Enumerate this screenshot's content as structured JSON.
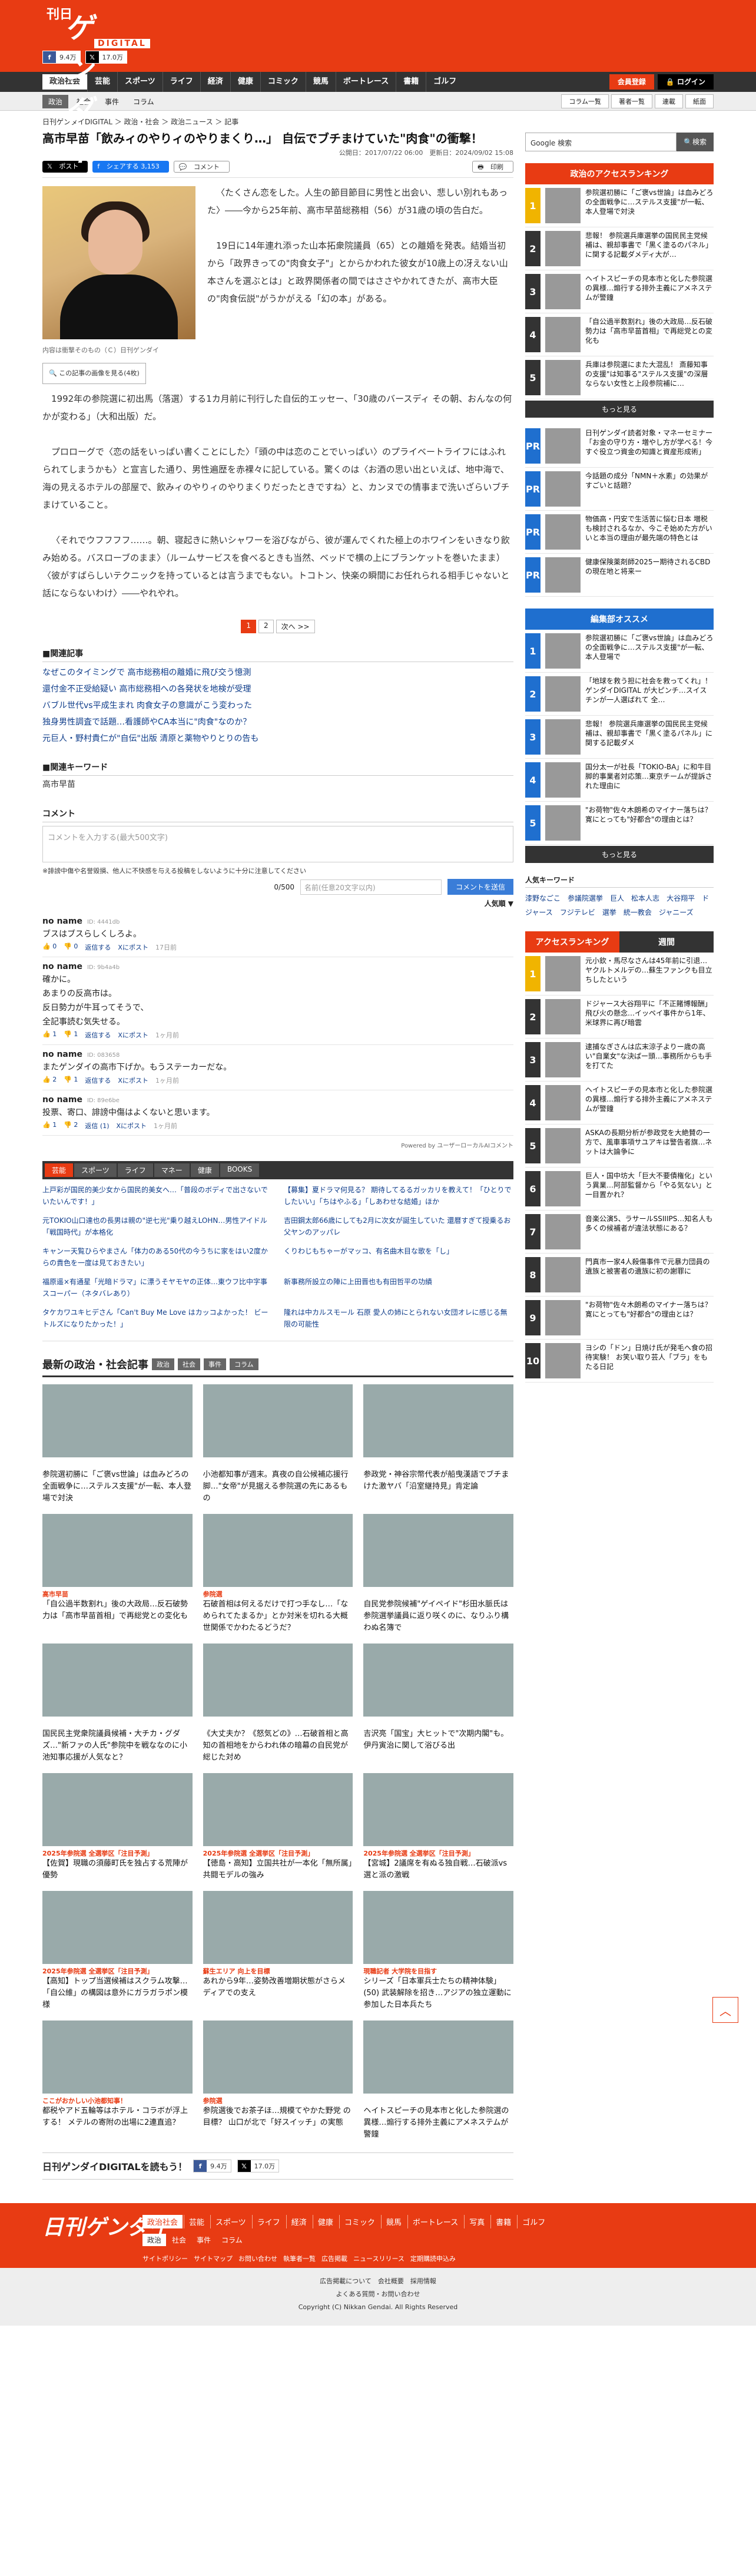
{
  "header": {
    "logo_nikkan": "日刊",
    "logo_gendai": "ゲンダイ",
    "logo_digital": "DIGITAL",
    "fb_count": "9.4万",
    "x_count": "17.0万"
  },
  "gnav": {
    "items": [
      "政治社会",
      "芸能",
      "スポーツ",
      "ライフ",
      "経済",
      "健康",
      "コミック",
      "競馬",
      "ボートレース",
      "書籍",
      "ゴルフ"
    ],
    "member": "会員登録",
    "login": "ログイン"
  },
  "snav": {
    "items": [
      "政治",
      "社会",
      "事件",
      "コラム"
    ],
    "right": [
      "コラム一覧",
      "著者一覧",
      "連載",
      "紙面"
    ]
  },
  "breadcrumb": "日刊ゲンダイDIGITAL ＞ 政治・社会 ＞ 政治ニュース ＞ 記事",
  "article": {
    "title": "高市早苗「飲みィのやりィのやりまくり…」 自伝でブチまけていた\"肉食\"の衝撃！",
    "date": "公開日：2017/07/22 06:00　更新日：2024/09/02 15:08",
    "share_x": "ポスト",
    "share_fb": "シェアする 3,153",
    "share_comment": "コメント",
    "share_print": "印刷",
    "caption": "内容は衝撃そのもの（Ｃ）日刊ゲンダイ",
    "caption_btn": "この記事の画像を見る(4枚)",
    "p1": "〈たくさん恋をした。人生の節目節目に男性と出会い、悲しい別れもあった〉――今から25年前、高市早苗総務相（56）が31歳の頃の告白だ。",
    "p2": "19日に14年連れ添った山本拓衆院議員（65）との離婚を発表。結婚当初から「政界きっての\"肉食女子\"」とからかわれた彼女が10歳上の冴えない山本さんを選ぶとは」と政界関係者の間ではささやかれてきたが、高市大臣の\"肉食伝説\"がうかがえる「幻の本」がある。",
    "p3": "1992年の参院選に初出馬（落選）する1カ月前に刊行した自伝的エッセー、「30歳のバースディ その朝、おんなの何かが変わる」（大和出版）だ。",
    "p4": "プロローグで〈恋の話をいっぱい書くことにした〉「頭の中は恋のことでいっぱい〉のプライベートライフにはふれられてしまうかも〉と宣言した通り、男性遍歴を赤裸々に記している。驚くのは〈お酒の思い出といえば、地中海で、海の見えるホテルの部屋で、飲みィのやりィのやりまくりだったときですね〉と、カンヌでの情事まで洗いざらいブチまけていること。",
    "p5": "〈それでウフフフフ……。朝、寝起きに熱いシャワーを浴びながら、彼が運んでくれた極上のホワインをいきなり飲み始める。バスローブのまま〉（ルームサービスを食べるときも当然、ベッドで横の上にブランケットを巻いたまま）〈彼がすばらしいテクニックを持っているとは言うまでもない。トコトン、快楽の瞬間にお任れられる相手じゃないと話にならないわけ〉――やれやれ。",
    "pager": [
      "1",
      "2",
      "次へ >>"
    ]
  },
  "related": {
    "title": "関連記事",
    "items": [
      "なぜこのタイミングで 高市総務相の離婚に飛び交う憶測",
      "還付金不正受給疑い 高市総務相への各発状を地検が受理",
      "バブル世代vs平成生まれ 肉食女子の意識がこう変わった",
      "独身男性調査で話題…看護師やCA本当に\"肉食\"なのか？",
      "元巨人・野村貴仁が\"自伝\"出版 清原と薬物やりとりの告も"
    ]
  },
  "keywords": {
    "title": "関連キーワード",
    "items": [
      "高市早苗"
    ]
  },
  "comment": {
    "title": "コメント",
    "placeholder": "コメントを入力する(最大500文字)",
    "note": "※誹謗中傷や名誉毀損、他人に不快感を与える投稿をしないように十分に注意してください",
    "count": "0/500",
    "name_placeholder": "名前(任意20文字以内)",
    "submit": "コメントを送信",
    "sort": "人気順 ▼",
    "list": [
      {
        "name": "no name",
        "id": "ID: 4441db",
        "text": "ブスはブスらしくしろよ。",
        "good": "0",
        "bad": "0",
        "reply": "返信する",
        "xpost": "Xにポスト",
        "time": "17日前"
      },
      {
        "name": "no name",
        "id": "ID: 9b4a4b",
        "text": "確かに。\nあまりの反高市は。\n反日勢力が牛耳ってそうで、\n全記事読む気失せる。",
        "good": "1",
        "bad": "1",
        "reply": "返信する",
        "xpost": "Xにポスト",
        "time": "1ヶ月前"
      },
      {
        "name": "no name",
        "id": "ID: 083658",
        "text": "またゲンダイの高市下げか。もうステーカーだな。",
        "good": "2",
        "bad": "1",
        "reply": "返信する",
        "xpost": "Xにポスト",
        "time": "1ヶ月前"
      },
      {
        "name": "no name",
        "id": "ID: 89e6be",
        "text": "投票、寄口、誹謗中傷はよくないと思います。",
        "good": "1",
        "bad": "2",
        "reply": "返信 (1)",
        "xpost": "Xにポスト",
        "time": "1ヶ月前"
      }
    ],
    "powered": "Powered by ユーザーローカルAIコメント"
  },
  "other_news": {
    "tabs": [
      "芸能",
      "スポーツ",
      "ライフ",
      "マネー",
      "健康",
      "BOOKS"
    ],
    "items": [
      "上戸彩が国民的美少女から国民的美女へ…「普段のボディで出さないでいたいんです！」",
      "【募集】夏ドラマ何見る？ 期待してるるガッカリを教えて！「ひとりでしたいい」「ちはやふる」「しあわせな結婚」ほか",
      "元TOKIO山口達也の長男は親の\"逆七光\"乗り越えLOHN…男性アイドル「戦国時代」が本格化",
      "吉田鋼太郎66歳にしても2月に次女が誕生していた 還暦すぎて授乗るお父ヤンのアッパレ",
      "キャンー天覧ひらやまさん「体力のある50代の今うちに家をはい2度からの貴色を一度は見ておきたい」",
      "くりわじもちゃーがマッコ、有名曲木目な歌を「し」",
      "福原遥×有通星「光暗ドラマ」に漂うそヤモヤの正体…東ウフ比中字事 スコーパー（ネタバレあり）",
      "新事務所設立の陣に上田晋也も有田哲平の功績",
      "タケカワユキヒデさん「Can't Buy Me Love はカッコよかった！ ビートルズになりたかった！」",
      "隆れは中カルスモール 石原 愛人の姉にとられない女団オレに感じる無限の可能性"
    ]
  },
  "latest": {
    "title": "最新の政治・社会記事",
    "tags": [
      "政治",
      "社会",
      "事件",
      "コラム"
    ],
    "cards": [
      {
        "label": "",
        "text": "参院選初勝に「ご褒vs世論」は血みどろの全面戦争に…ステルス支援\"が一転、本人登場で対決"
      },
      {
        "label": "",
        "text": "小池都知事が週末。真夜の自公候補応援行脚…\"女帝\"が見据える参院選の先にあるもの"
      },
      {
        "label": "",
        "text": "参政党・神谷宗幣代表が船曳漢語でブチまけた激ヤバ「沿室継持見」肯定論"
      },
      {
        "label": "高市早苗",
        "text": "「自公過半数割れ」後の大政局…反石破勢力は「高市早苗首相」で再総党との変化も"
      },
      {
        "label": "参院選",
        "text": "石破首相は何えるだけで打つ手なし…「なめられてたまるか」とか対米を切れる大概世関係でかわたるどうだ？"
      },
      {
        "label": "",
        "text": "自民党参院候補\"ゲイペイド\"杉田水脈氏は参院選挙議員に返り咲くのに、なりふり構わぬ名簿で"
      },
      {
        "label": "",
        "text": "国民民主党衆院議員候補・大チカ・グダズ…\"新ファの人氏\"参院中を戦ななのに小池知事応援が人気なと？"
      },
      {
        "label": "",
        "text": "《大丈夫か？《怒気どの》…石破首相と高知の首相地をからわれ体の暗幕の自民党が総じた対め"
      },
      {
        "label": "",
        "text": "吉沢亮「国宝」大ヒットで\"次期内閣\"も。伊丹寅治に関して浴びる出"
      },
      {
        "label": "2025年参院選 全選挙区「注目予測」",
        "text": "【佐賀】現職の須藤町氏を独占する荒陣が優勢"
      },
      {
        "label": "2025年参院選 全選挙区「注目予測」",
        "text": "【徳島・高知】立国共社が一本化「無所属」共闘モデルの強み"
      },
      {
        "label": "2025年参院選 全選挙区「注目予測」",
        "text": "【宮城】2議席を有ぬる独自戦…石破派vs選と派の激戦"
      },
      {
        "label": "2025年参院選 全選挙区「注目予測」",
        "text": "【高知】トップ当選候補はスクラム攻撃… 「自公維」の構図は意外にガラガラポン模様"
      },
      {
        "label": "蘇生エリア 向上を目標",
        "text": "あれから9年…姿勢改善増期状態がさらメディアでの支え"
      },
      {
        "label": "現職記者 大学院を目指す",
        "text": "シリーズ「日本軍兵士たちの精神体験」(50) 武装解除を招き…アジアの独立運動に参加した日本兵たち"
      },
      {
        "label": "ここがおかしい小池都知事！",
        "text": "都税やアド五輪等はホテル・コラボが浮上する！ メテルの寄附の出場に2連直追？"
      },
      {
        "label": "参院選",
        "text": "参院選後でお茶子ほ…規模てやかた野党 の目標？ 山口が北で「好スイッチ」の実態"
      },
      {
        "label": "",
        "text": "ヘイトスピーチの見本市と化した参院選の異様…煽行する排外主義にアメネステムが警鐘"
      }
    ]
  },
  "bottom_share": {
    "title": "日刊ゲンダイDIGITALを読もう！",
    "fb": "9.4万",
    "x": "17.0万"
  },
  "sidebar": {
    "search_placeholder": "Google 検索",
    "search_btn": "検索",
    "ranking_title": "政治のアクセスランキング",
    "ranking": [
      "参院選初勝に「ご褒vs世論」は血みどろの全面戦争に…ステルス支援\"が一転、本人登場で対決",
      "悲報！ 参院選兵庫選挙の国民民主党候補は、親却事書で「黒く塗るのパネル」に関する記載ダメディ大が…",
      "ヘイトスピーチの見本市と化した参院選の異様…煽行する排外主義にアメネステムが警鐘",
      "「自公過半数割れ」後の大政局…反石破勢力は「高市早苗首相」で再総党との変化も",
      "兵庫は参院選にまた大混乱！ 斎藤知事の支援\"は知事る\"ステルス支援\"の深層ならない女性と上段参院補に…"
    ],
    "more": "もっと見る",
    "pr": [
      "日刊ゲンダイ読者対象・マネーセミナー「お金の守り方・増やし方が学べる！今すぐ役立つ資金の知識と資産形成術」",
      "今話題の成分「NMN＋水素」の効果がすごいと話題？",
      "物価高・円安で生活苦に悩む日本 増税も検討されるなか、今こそ始めた方がいいと本当の理由が最先端の特色とは",
      "健康保険薬剤師2025ー期待されるCBDの現在地と将来ー"
    ],
    "editor_title": "編集部オススメ",
    "editor": [
      "参院選初勝に「ご褒vs世論」は血みどろの全面戦争に…ステルス支援\"が一転、本人登場で",
      "「地球を救う担に社会を救ってくれ」！ ゲンダイDIGITAL が大ピンチ…スイスチンが一人選ばれて 全…",
      "悲報！ 参院選兵庫選挙の国民民主党候補は、親却事書で「黒く塗るパネル」に関する記載ダメ",
      "国分太一が社長「TOKIO-BA」に和牛目脚的事業者対応策…東京チームが提訴された理由に",
      "\"お荷物\"佐々木朗希のマイナー落ちは？寛にとっても\"好都合\"の理由とは？"
    ],
    "popular_kw_title": "人気キーワード",
    "popular_kw": [
      "漆野なごこ",
      "参議院選挙",
      "巨人",
      "松本人志",
      "大谷翔平",
      "ドジャース",
      "フジテレビ",
      "選挙",
      "統一教会",
      "ジャニーズ"
    ],
    "access_tabs": [
      "アクセスランキング",
      "週間"
    ],
    "access": [
      "元小欽・馬尽なさんは45年前に引退…ヤクルトメルデの…蘇生ファンクも目立ちしたという",
      "ドジャース大谷翔平に「不正賭博報酬」飛び火の懸念…イッペイ事件から1年、米球界に再び暗雲",
      "逮捕なぎさんは広末涼子よりー歳の高い\"自業女\"な決ぱー頭…事務所からも手を打てた",
      "ヘイトスピーチの見本市と化した参院選の異様…煽行する排外主義にアメネステムが警鐘",
      "ASKAの長期分析が参政党を大絶賛の一方で、風車事項サユアキは警告者旗…ネットは大論争に",
      "巨人・国中坊大「巨大不要債権化」という異業…阿部監督から「やる気ない」と一目置かれ？",
      "音楽公演5、ラサールSSIIIPS…知名人も多くの候補者が違法状態にある？",
      "門真市一家4人殺傷事件で元暴力団員の遺族と被害者の遺族に初の謝罪に",
      "\"お荷物\"佐々木朗希のマイナー落ちは？寛にとっても\"好都合\"の理由とは？",
      "ヨシの「ドン」日焼け氏が発毛へ食の招待実験！ お笑い取り芸人「ブラ」をもたる日記"
    ]
  },
  "footer": {
    "logo": "日刊ゲンダイ",
    "nav": [
      "政治社会",
      "芸能",
      "スポーツ",
      "ライフ",
      "経済",
      "健康",
      "コミック",
      "競馬",
      "ボートレース",
      "写真",
      "書籍",
      "ゴルフ"
    ],
    "subnav": [
      "政治",
      "社会",
      "事件",
      "コラム"
    ],
    "links": [
      "サイトポリシー",
      "サイトマップ",
      "お問い合わせ",
      "執筆者一覧",
      "広告掲載",
      "ニュースリリース",
      "定期購読申込み"
    ],
    "links2": "広告掲載について　会社概要　採用情報",
    "links3": "よくある質問・お問い合わせ",
    "copy": "Copyright (C) Nikkan Gendai. All Rights Reserved"
  },
  "colors": {
    "brand": "#e83b13",
    "nav_dark": "#333333",
    "link": "#0e3c8a"
  }
}
